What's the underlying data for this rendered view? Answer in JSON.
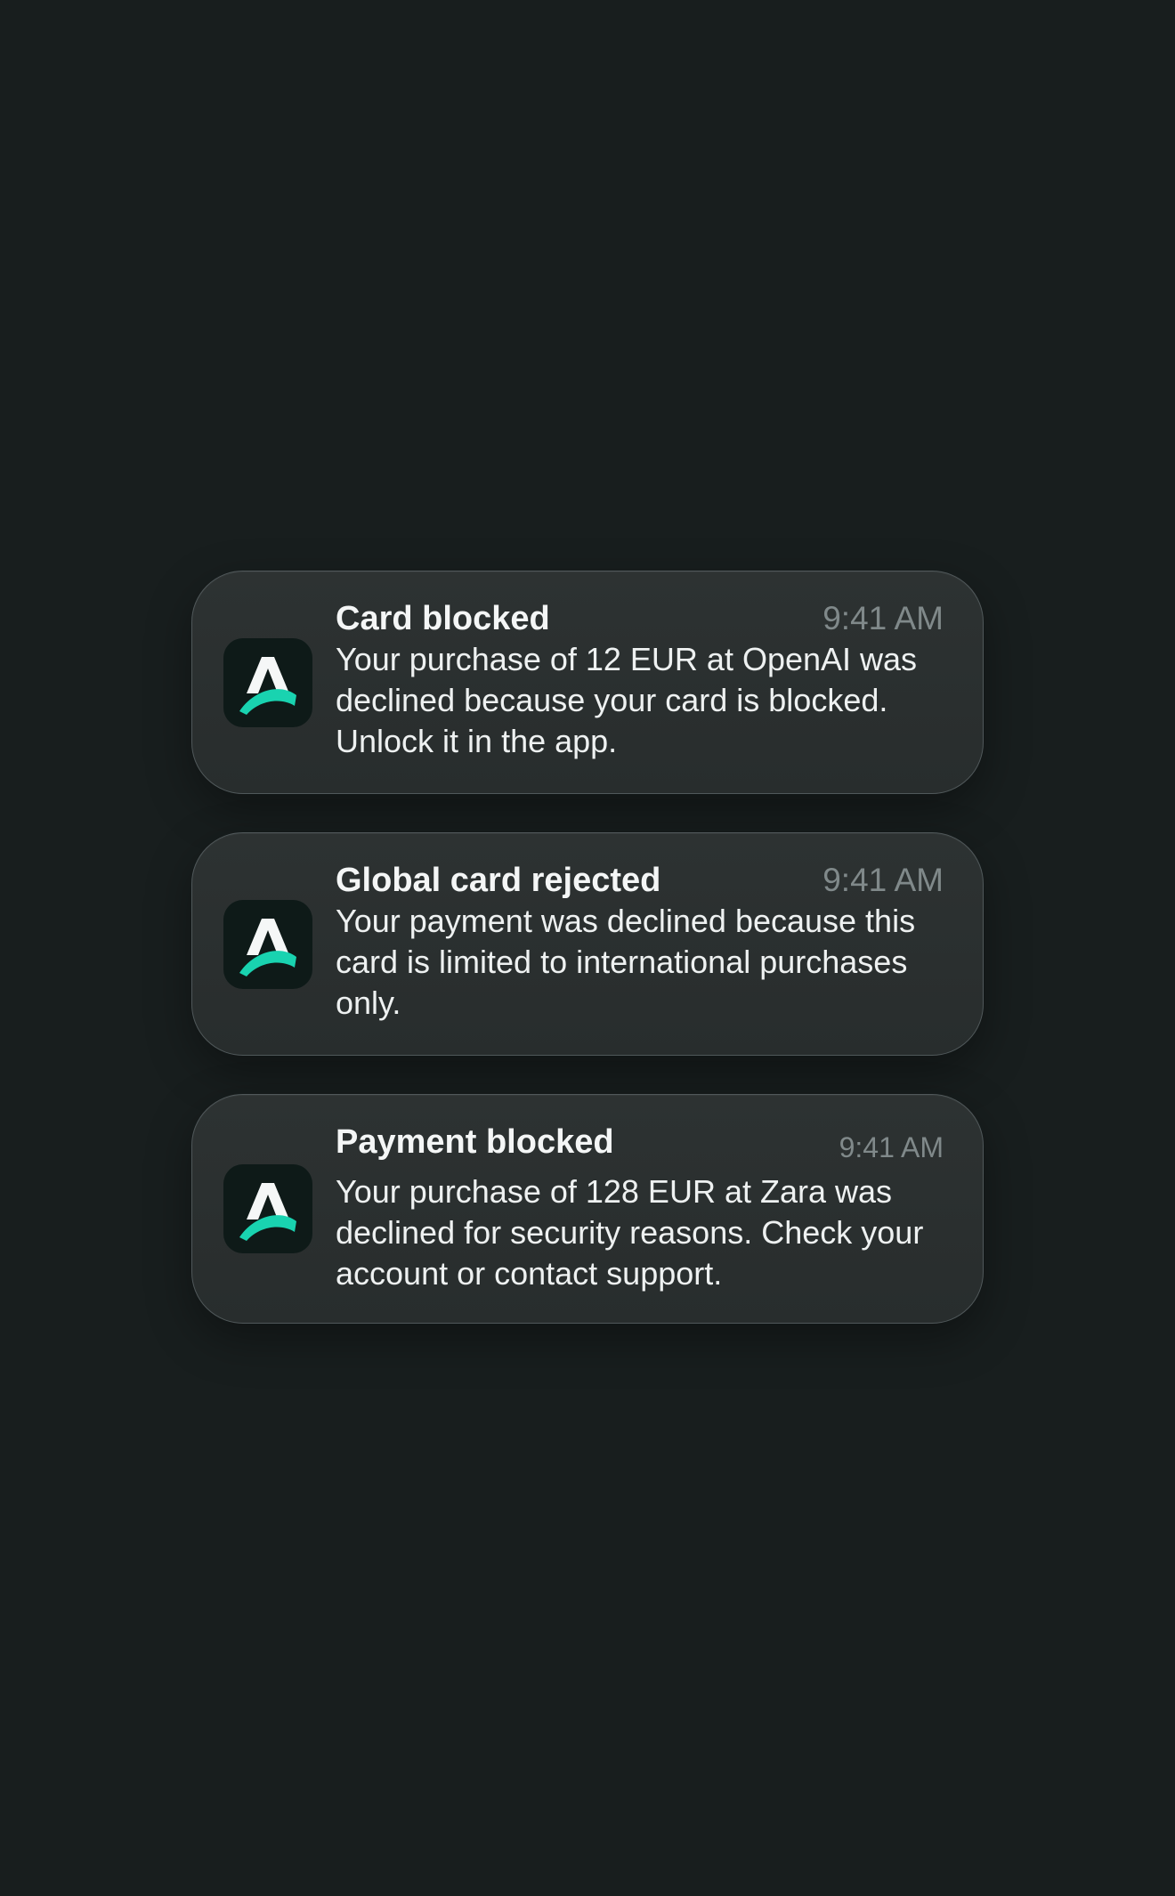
{
  "notifications": [
    {
      "app_icon": "app-logo-a-icon",
      "title": "Card blocked",
      "time": "9:41 AM",
      "body": "Your purchase of 12 EUR at OpenAI was declined because your card is blocked. Unlock it in the app."
    },
    {
      "app_icon": "app-logo-a-icon",
      "title": "Global card rejected",
      "time": "9:41 AM",
      "body": "Your payment was declined because this card is limited to international purchases only."
    },
    {
      "app_icon": "app-logo-a-icon",
      "title": "Payment blocked",
      "time": "9:41 AM",
      "body": "Your purchase of 128 EUR at Zara was declined for security reasons. Check your account or contact support."
    }
  ],
  "colors": {
    "background": "#181e1e",
    "card": "#2b3030",
    "icon_background": "#0e1a18",
    "accent": "#19d3b0",
    "title_text": "#f4f6f6",
    "time_text": "#80898a"
  }
}
